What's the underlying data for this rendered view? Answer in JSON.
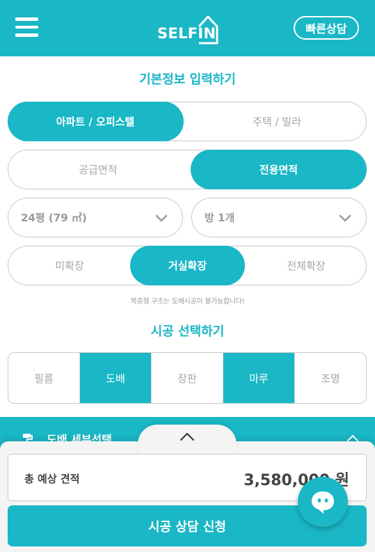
{
  "colors": {
    "accent": "#1ab7c6",
    "border": "#c9c9c9",
    "muted": "#a6a6a6"
  },
  "header": {
    "logo_text": "SELFIN",
    "quick_consult": "빠른상담",
    "menu_icon": "hamburger-icon"
  },
  "basic_info": {
    "title": "기본정보 입력하기",
    "property_type": {
      "options": [
        "아파트 / 오피스텔",
        "주택 / 빌라"
      ],
      "selected": 0
    },
    "area_type": {
      "options": [
        "공급면적",
        "전용면적"
      ],
      "selected": 1
    },
    "size_select": {
      "value": "24평 (79 ㎡)"
    },
    "room_select": {
      "value": "방 1개"
    },
    "extension": {
      "options": [
        "미확장",
        "거실확장",
        "전체확장"
      ],
      "selected": 1
    },
    "notice": "복층형 구조는 도배시공이 불가능합니다!"
  },
  "construction": {
    "title": "시공 선택하기",
    "options": [
      {
        "label": "필름",
        "active": false
      },
      {
        "label": "도배",
        "active": true
      },
      {
        "label": "장판",
        "active": false
      },
      {
        "label": "마루",
        "active": true
      },
      {
        "label": "조명",
        "active": false
      }
    ]
  },
  "sub_section": {
    "label": "도배 세부선택"
  },
  "bottom_panel": {
    "estimate_label": "총 예상 견적",
    "estimate_amount": "3,580,000 원",
    "apply_button": "시공 상담 신청"
  }
}
